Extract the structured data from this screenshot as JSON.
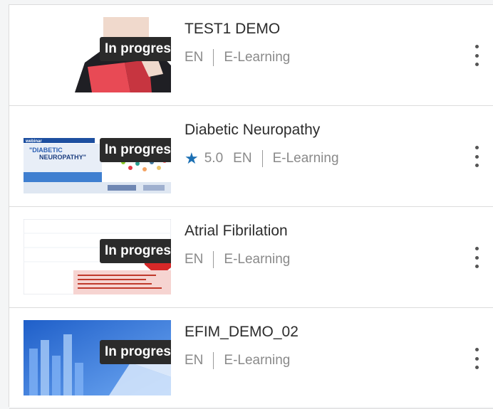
{
  "items": [
    {
      "title": "TEST1 DEMO",
      "status": "In progress",
      "rating": "",
      "language": "EN",
      "type": "E-Learning"
    },
    {
      "title": "Diabetic Neuropathy",
      "status": "In progress",
      "rating": "5.0",
      "language": "EN",
      "type": "E-Learning",
      "thumb_text": {
        "banner": "webinar",
        "line1": "\"DIABETIC",
        "line2": "NEUROPATHY\""
      }
    },
    {
      "title": "Atrial Fibrilation",
      "status": "In progress",
      "rating": "",
      "language": "EN",
      "type": "E-Learning"
    },
    {
      "title": "EFIM_DEMO_02",
      "status": "In progress",
      "rating": "",
      "language": "EN",
      "type": "E-Learning"
    }
  ],
  "colors": {
    "badge": "#2b2b2b",
    "star": "#1a6fb3",
    "divider": "#dcdcdc"
  },
  "icons": {
    "rating": "star-icon",
    "menu": "more-vertical-icon"
  }
}
